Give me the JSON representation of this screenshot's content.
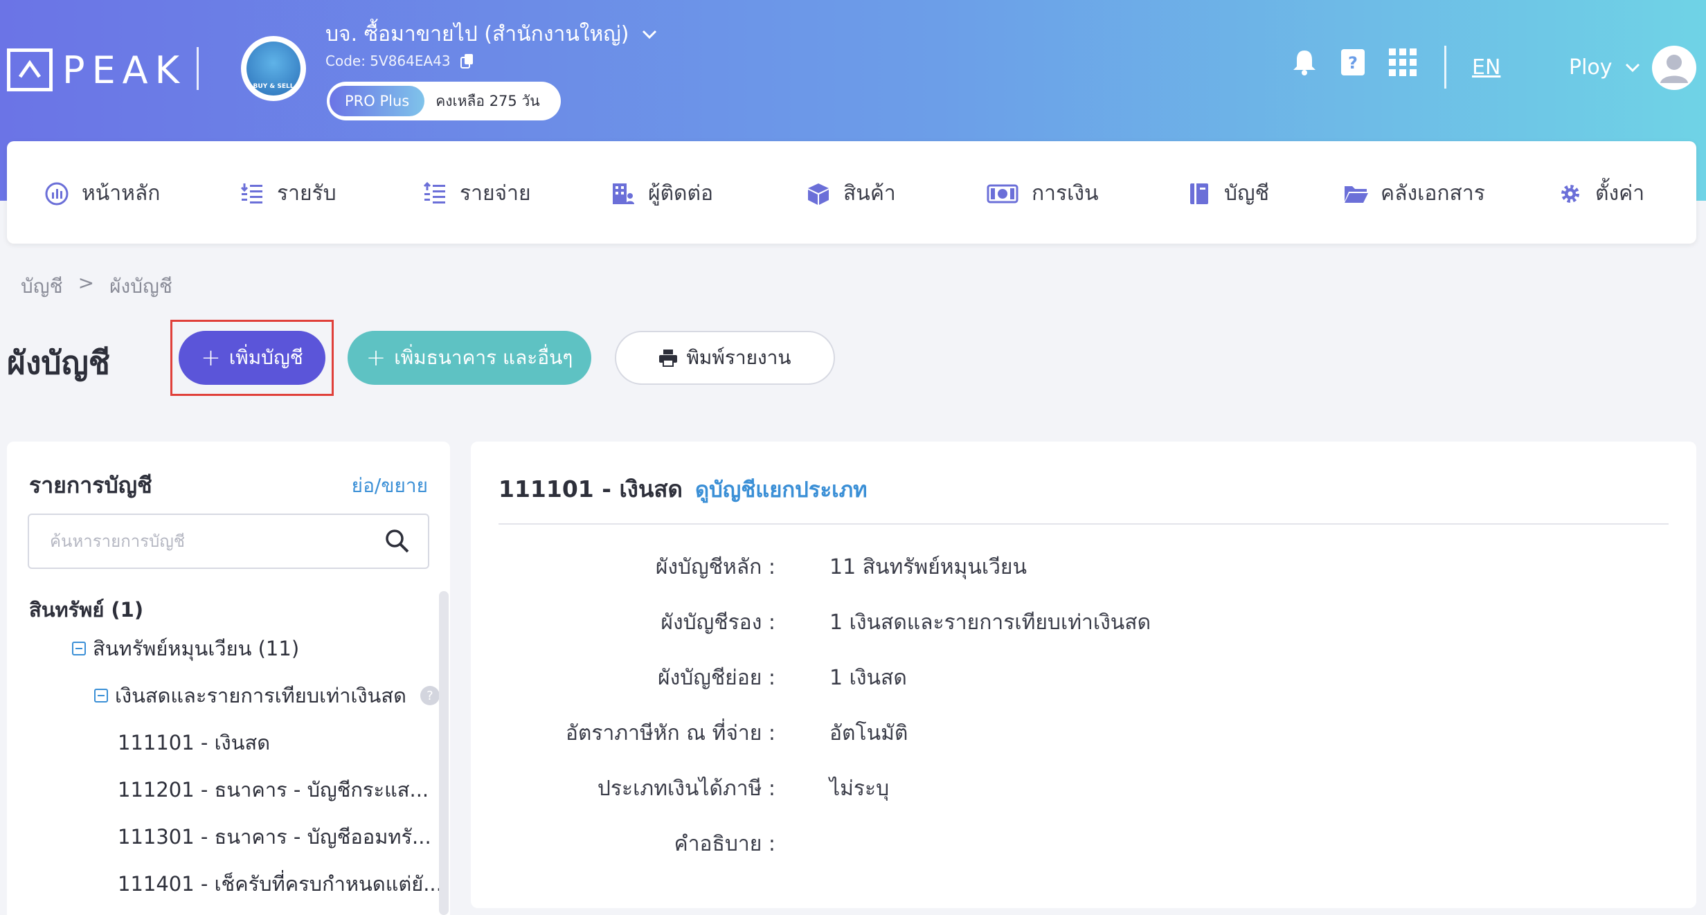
{
  "header": {
    "logo_text": "PEAK",
    "company_name": "บจ. ซื้อมาขายไป (สำนักงานใหญ่)",
    "company_code": "Code: 5V864EA43",
    "avatar_text": "BUY & SELL",
    "plan_badge": "PRO Plus",
    "plan_remaining": "คงเหลือ 275 วัน",
    "language": "EN",
    "user_name": "Ploy"
  },
  "nav": {
    "items": [
      {
        "label": "หน้าหลัก",
        "icon": "dashboard-icon"
      },
      {
        "label": "รายรับ",
        "icon": "income-icon"
      },
      {
        "label": "รายจ่าย",
        "icon": "expense-icon"
      },
      {
        "label": "ผู้ติดต่อ",
        "icon": "contacts-icon"
      },
      {
        "label": "สินค้า",
        "icon": "product-box-icon"
      },
      {
        "label": "การเงิน",
        "icon": "money-icon"
      },
      {
        "label": "บัญชี",
        "icon": "ledger-icon"
      },
      {
        "label": "คลังเอกสาร",
        "icon": "folder-icon"
      },
      {
        "label": "ตั้งค่า",
        "icon": "gear-icon"
      }
    ]
  },
  "breadcrumb": {
    "root": "บัญชี",
    "separator": ">",
    "current": "ผังบัญชี"
  },
  "page": {
    "title": "ผังบัญชี",
    "add_account_label": "เพิ่มบัญชี",
    "add_bank_label": "เพิ่มธนาคาร และอื่นๆ",
    "print_label": "พิมพ์รายงาน"
  },
  "left_panel": {
    "title": "รายการบัญชี",
    "toggle_label": "ย่อ/ขยาย",
    "search_placeholder": "ค้นหารายการบัญชี",
    "tree": [
      {
        "label": "สินทรัพย์ (1)",
        "level": 0
      },
      {
        "label": "สินทรัพย์หมุนเวียน (11)",
        "level": 1
      },
      {
        "label": "เงินสดและรายการเทียบเท่าเงินสด",
        "level": 2
      },
      {
        "label": "111101 - เงินสด",
        "level": 3
      },
      {
        "label": "111201 - ธนาคาร - บัญชีกระแส...",
        "level": 3
      },
      {
        "label": "111301 - ธนาคาร - บัญชีออมทรั...",
        "level": 3
      },
      {
        "label": "111401 - เช็ครับที่ครบกำหนดแต่ยั...",
        "level": 3
      }
    ]
  },
  "detail": {
    "heading": "111101 - เงินสด",
    "ledger_link": "ดูบัญชีแยกประเภท",
    "rows": [
      {
        "label": "ผังบัญชีหลัก :",
        "value": "11 สินทรัพย์หมุนเวียน"
      },
      {
        "label": "ผังบัญชีรอง :",
        "value": "1 เงินสดและรายการเทียบเท่าเงินสด"
      },
      {
        "label": "ผังบัญชีย่อย :",
        "value": "1 เงินสด"
      },
      {
        "label": "อัตราภาษีหัก ณ ที่จ่าย :",
        "value": "อัตโนมัติ"
      },
      {
        "label": "ประเภทเงินได้ภาษี :",
        "value": "ไม่ระบุ"
      },
      {
        "label": "คำอธิบาย :",
        "value": ""
      }
    ]
  },
  "colors": {
    "primary": "#5b55d9",
    "teal": "#5ec2c3",
    "link": "#3a8fd6",
    "highlight": "#e0403a"
  }
}
